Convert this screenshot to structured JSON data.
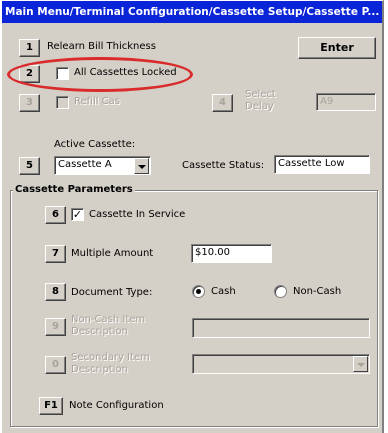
{
  "window": {
    "title": "Main Menu/Terminal Configuration/Cassette Setup/Cassette P..."
  },
  "colors": {
    "titlebar": "#0a24d8",
    "highlight": "#d92b2b",
    "face": "#d4d0c8"
  },
  "top": {
    "relearn": {
      "key": "1",
      "label": "Relearn Bill Thickness"
    },
    "enter_label": "Enter",
    "locked": {
      "key": "2",
      "label": "All Cassettes Locked",
      "checked": false
    },
    "refill": {
      "key": "3",
      "label": "Refill Cas"
    },
    "select": {
      "key": "4",
      "label_line1": "Select",
      "label_line2": "Delay",
      "value": "A9"
    }
  },
  "active": {
    "title": "Active Cassette:",
    "key": "5",
    "value": "Cassette A",
    "status_label": "Cassette Status:",
    "status_value": "Cassette Low"
  },
  "params": {
    "title": "Cassette Parameters",
    "in_service": {
      "key": "6",
      "label": "Cassette In Service",
      "checked": true
    },
    "multiple": {
      "key": "7",
      "label": "Multiple Amount",
      "value": "$10.00"
    },
    "doc_type": {
      "key": "8",
      "label": "Document Type:",
      "options": [
        "Cash",
        "Non-Cash"
      ],
      "selected": "Cash"
    },
    "noncash_denom": {
      "key": "9",
      "label_line1": "Non-Cash Item",
      "label_line2": "Description",
      "value": ""
    },
    "secondary_denom": {
      "key": "0",
      "label_line1": "Secondary Item",
      "label_line2": "Description",
      "value": ""
    },
    "note_config": {
      "key": "F1",
      "label": "Note Configuration"
    }
  }
}
